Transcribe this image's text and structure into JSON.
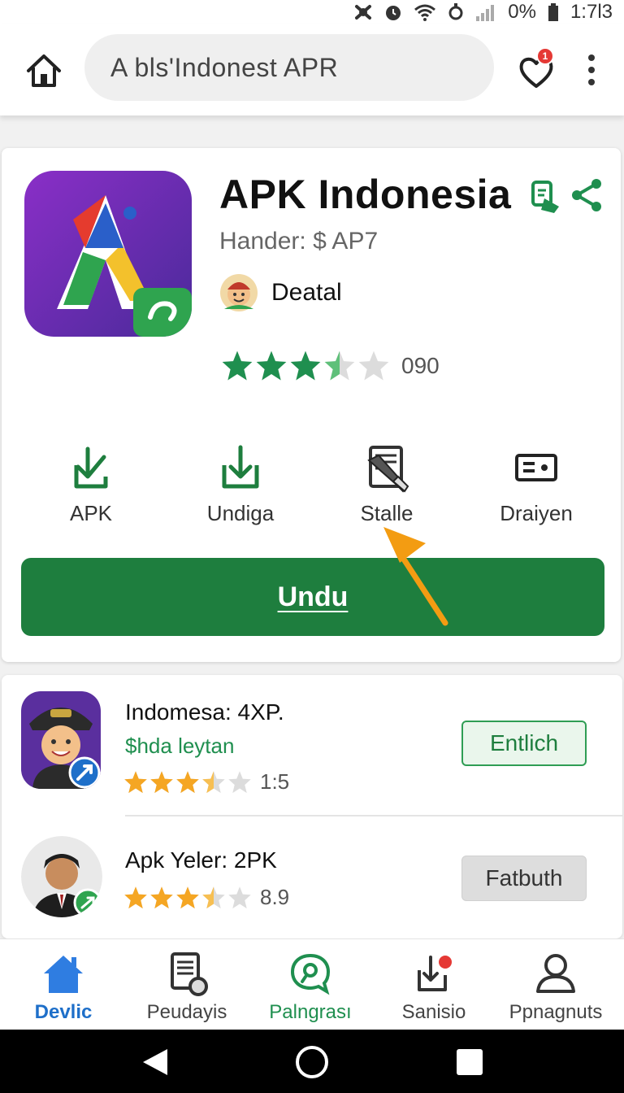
{
  "status_bar": {
    "battery_text": "0%",
    "time": "1:7l3"
  },
  "search": {
    "query": "A bls'Indonest APR"
  },
  "favorites": {
    "badge_count": "1"
  },
  "app": {
    "title": "APK Indonesia",
    "subtitle": "Hander: $ AP7",
    "developer": "Deatal",
    "rating_stars": 3.5,
    "rating_count": "090"
  },
  "actions": [
    {
      "label": "APK",
      "icon": "download-arrow-icon"
    },
    {
      "label": "Undiga",
      "icon": "download-tray-icon"
    },
    {
      "label": "Stalle",
      "icon": "document-pen-icon"
    },
    {
      "label": "Draiyen",
      "icon": "card-icon"
    }
  ],
  "download_button": {
    "label": "Undu"
  },
  "list": [
    {
      "title": "Indomesa: 4XP.",
      "subtitle": "$hda leytan",
      "rating_stars": 3.5,
      "rating_count": "1:5",
      "button": "Entlich"
    },
    {
      "title": "Apk Yeler: 2PK",
      "subtitle": "",
      "rating_stars": 3.5,
      "rating_count": "8.9",
      "button": "Fatbuth"
    }
  ],
  "bottom_nav": [
    {
      "label": "Devlic",
      "icon": "home-icon"
    },
    {
      "label": "Peudayis",
      "icon": "document-icon"
    },
    {
      "label": "Palngrası",
      "icon": "chat-icon"
    },
    {
      "label": "Sanisio",
      "icon": "download-inbox-icon"
    },
    {
      "label": "Ppnagnuts",
      "icon": "person-icon"
    }
  ],
  "colors": {
    "primary_green": "#1e7e3e",
    "star_green": "#1f8f4f",
    "star_orange": "#f5a623",
    "active_nav_blue": "#1e6fc9",
    "badge_red": "#e53935",
    "pointer_orange": "#f39c12"
  }
}
